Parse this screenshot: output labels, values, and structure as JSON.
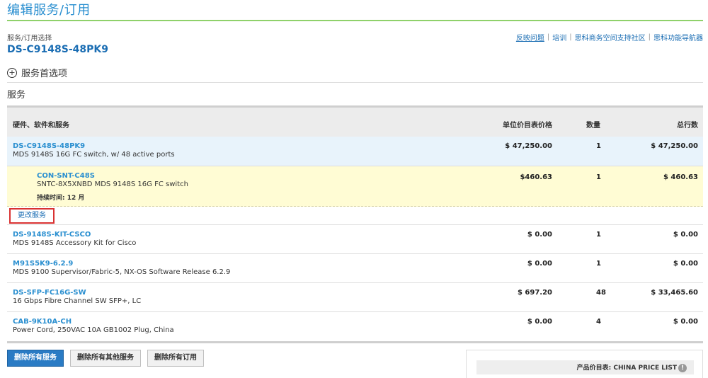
{
  "page": {
    "title": "编辑服务/订用",
    "subhead_label": "服务/订用选择",
    "product_id": "DS-C9148S-48PK9"
  },
  "top_links": [
    "反映问题",
    "培训",
    "思科商务空间支持社区",
    "思科功能导航器"
  ],
  "service_preferences_label": "服务首选项",
  "section_label": "服务",
  "table": {
    "headers": {
      "item": "硬件、软件和服务",
      "unit_price": "单位价目表价格",
      "qty": "数量",
      "total": "总行数"
    },
    "rows": [
      {
        "sku": "DS-C9148S-48PK9",
        "desc": "MDS 9148S 16G FC switch, w/ 48 active ports",
        "price": "$ 47,250.00",
        "qty": "1",
        "total": "$ 47,250.00"
      },
      {
        "sku": "CON-SNT-C48S",
        "desc": "SNTC-8X5XNBD MDS 9148S 16G FC switch",
        "duration": "持续时间: 12 月",
        "price": "$460.63",
        "qty": "1",
        "total": "$ 460.63"
      },
      {
        "sku": "DS-9148S-KIT-CSCO",
        "desc": "MDS 9148S Accessory Kit for Cisco",
        "price": "$ 0.00",
        "qty": "1",
        "total": "$ 0.00"
      },
      {
        "sku": "M91S5K9-6.2.9",
        "desc": "MDS 9100 Supervisor/Fabric-5, NX-OS Software Release 6.2.9",
        "price": "$ 0.00",
        "qty": "1",
        "total": "$ 0.00"
      },
      {
        "sku": "DS-SFP-FC16G-SW",
        "desc": "16 Gbps Fibre Channel SW SFP+, LC",
        "price": "$ 697.20",
        "qty": "48",
        "total": "$ 33,465.60"
      },
      {
        "sku": "CAB-9K10A-CH",
        "desc": "Power Cord, 250VAC 10A GB1002 Plug, China",
        "price": "$ 0.00",
        "qty": "4",
        "total": "$ 0.00"
      }
    ]
  },
  "change_service_label": "更改服务",
  "buttons": {
    "delete_all_services": "删除所有服务",
    "delete_all_other_services": "删除所有其他服务",
    "delete_all_subscriptions": "删除所有订用"
  },
  "price_list": {
    "label": "产品价目表: CHINA PRICE LIST"
  },
  "colors": {
    "title_blue": "#2a8fd0",
    "accent_green": "#8fd16b",
    "primary_button": "#2a7bc4",
    "highlight_red": "#d93232"
  }
}
